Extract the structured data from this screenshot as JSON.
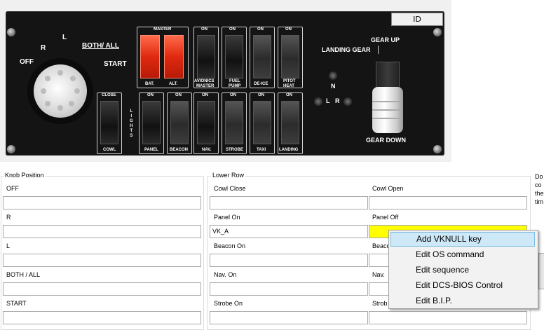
{
  "panel": {
    "id_label": "ID",
    "knob": {
      "off": "OFF",
      "r": "R",
      "l": "L",
      "both": "BOTH/ ALL",
      "start": "START"
    },
    "top_switches": {
      "master": "MASTER",
      "bat": "BAT.",
      "alt": "ALT.",
      "on": "ON",
      "avionics": "AVIONICS",
      "avionics_master": "MASTER",
      "fuel": "FUEL",
      "fuel_pump": "PUMP",
      "deice": "DE-ICE",
      "pitot": "PITOT",
      "pitot_heat": "HEAT"
    },
    "cowl": {
      "close": "CLOSE",
      "cowl": "COWL"
    },
    "lights_vertical": "L\nI\nG\nH\nT\nS",
    "bottom_switches": {
      "panel": "PANEL",
      "beacon": "BEACON",
      "nav": "NAV.",
      "strobe": "STROBE",
      "taxi": "TAXI",
      "landing": "LANDING"
    },
    "gear": {
      "landing_gear": "LANDING GEAR",
      "gear_up": "GEAR UP",
      "gear_down": "GEAR DOWN",
      "n": "N",
      "l": "L",
      "r": "R"
    }
  },
  "knob_group": {
    "title": "Knob Position",
    "fields": [
      {
        "label": "OFF",
        "value": ""
      },
      {
        "label": "R",
        "value": ""
      },
      {
        "label": "L",
        "value": ""
      },
      {
        "label": "BOTH / ALL",
        "value": ""
      },
      {
        "label": "START",
        "value": ""
      }
    ]
  },
  "lower_group": {
    "title": "Lower Row",
    "left": [
      {
        "label": "Cowl Close",
        "value": ""
      },
      {
        "label": "Panel On",
        "value": "VK_A"
      },
      {
        "label": "Beacon On",
        "value": ""
      },
      {
        "label": "Nav. On",
        "value": ""
      },
      {
        "label": "Strobe On",
        "value": ""
      }
    ],
    "right": [
      {
        "label": "Cowl Open",
        "value": ""
      },
      {
        "label": "Panel Off",
        "value": ""
      },
      {
        "label": "Beaco",
        "value": ""
      },
      {
        "label": "Nav.",
        "value": ""
      },
      {
        "label": "Strob",
        "value": ""
      }
    ]
  },
  "side_text": "Do\nco\nthe\ntim",
  "context_menu": [
    {
      "label": "Add VKNULL key"
    },
    {
      "label": "Edit OS command"
    },
    {
      "label": "Edit sequence"
    },
    {
      "label": "Edit DCS-BIOS Control"
    },
    {
      "label": "Edit B.I.P."
    }
  ],
  "colors": {
    "highlight_field": "#ffff00",
    "menu_highlight": "#cde8f7"
  }
}
